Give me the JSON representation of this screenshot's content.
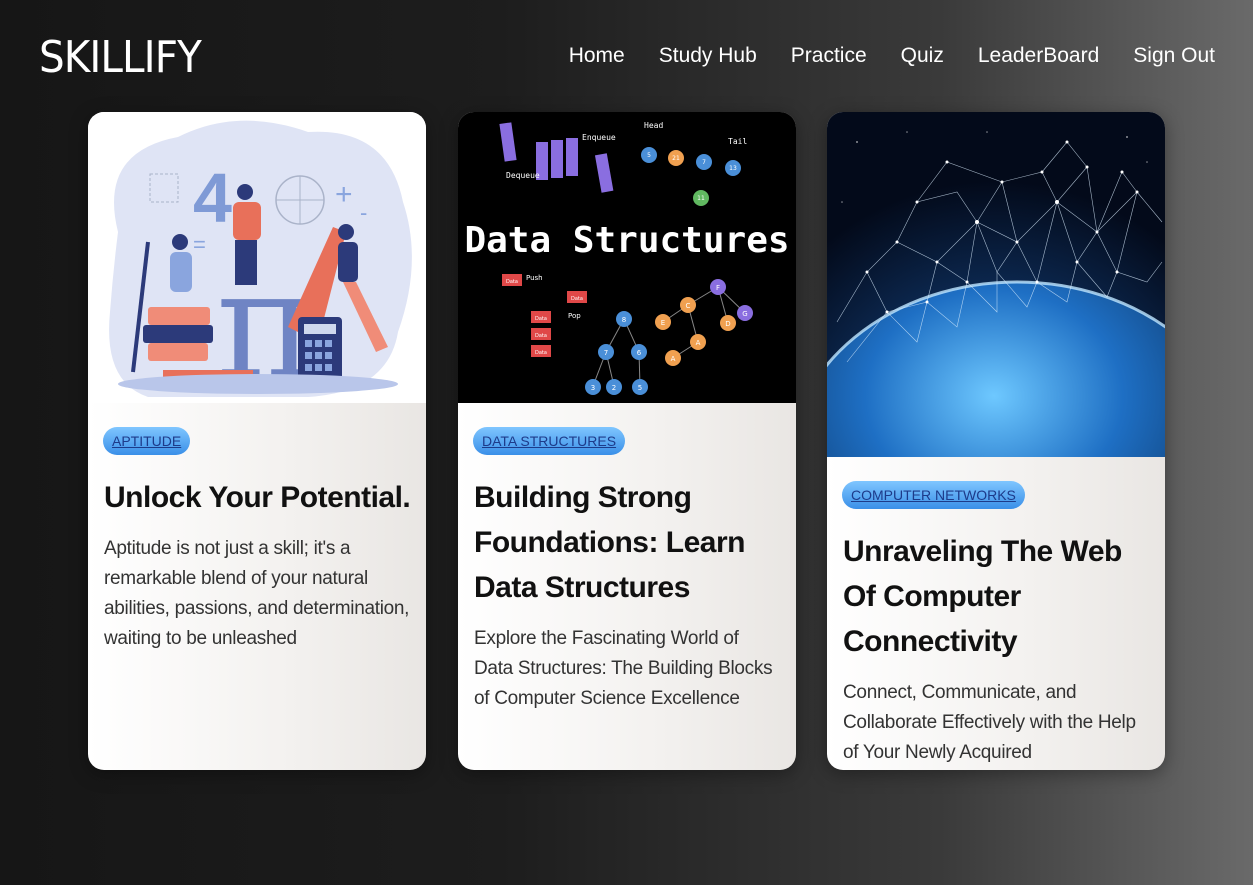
{
  "brand": "SKILLIFY",
  "nav": [
    "Home",
    "Study Hub",
    "Practice",
    "Quiz",
    "LeaderBoard",
    "Sign Out"
  ],
  "cards": [
    {
      "badge": "APTITUDE",
      "title": "Unlock Your Potential.",
      "description": "Aptitude is not just a skill; it's a remarkable blend of your natural abilities, passions, and determination, waiting to be unleashed"
    },
    {
      "badge": "DATA STRUCTURES",
      "title": "Building Strong Foundations: Learn Data Structures",
      "description": "Explore the Fascinating World of Data Structures: The Building Blocks of Computer Science Excellence",
      "image_text": {
        "heading": "Data Structures",
        "dequeue": "Dequeue",
        "enqueue": "Enqueue",
        "head": "Head",
        "tail": "Tail",
        "push": "Push",
        "pop": "Pop",
        "data": "Data",
        "node_values": [
          "5",
          "21",
          "7",
          "13",
          "11",
          "8",
          "7",
          "6",
          "3",
          "2",
          "5",
          "F",
          "C",
          "E",
          "G",
          "D",
          "A"
        ]
      }
    },
    {
      "badge": "COMPUTER NETWORKS",
      "title": "Unraveling The Web Of Computer Connectivity",
      "description": "Connect, Communicate, and Collaborate Effectively with the Help of Your Newly Acquired Understanding of Computer Networks"
    }
  ]
}
